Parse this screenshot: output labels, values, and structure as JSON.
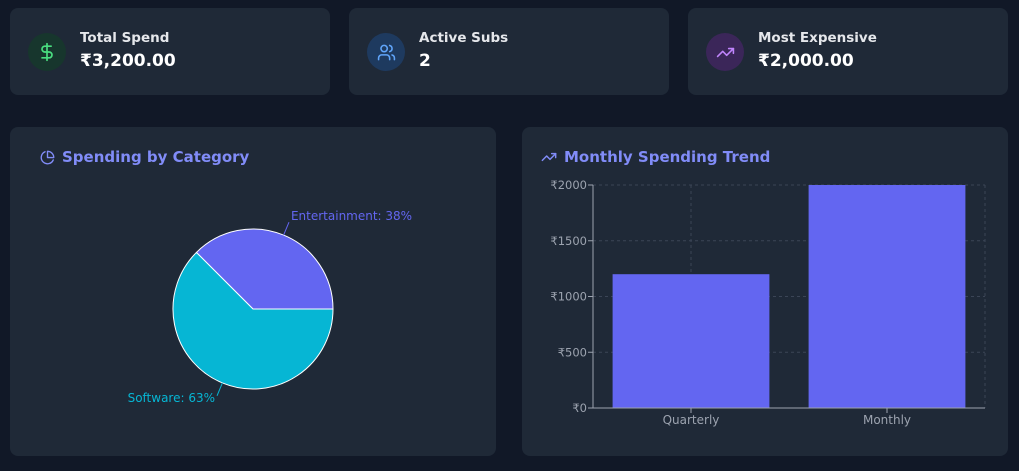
{
  "stats": [
    {
      "label": "Total Spend",
      "value": "₹3,200.00",
      "icon": "dollar-sign-icon",
      "icon_color": "#4ade80",
      "icon_bg": "#17362d"
    },
    {
      "label": "Active Subs",
      "value": "2",
      "icon": "users-icon",
      "icon_color": "#60a5fa",
      "icon_bg": "#1e3a5f"
    },
    {
      "label": "Most Expensive",
      "value": "₹2,000.00",
      "icon": "trending-up-icon",
      "icon_color": "#c084fc",
      "icon_bg": "#3b2659"
    }
  ],
  "category_panel": {
    "title": "Spending by Category",
    "icon": "pie-chart-icon"
  },
  "trend_panel": {
    "title": "Monthly Spending Trend",
    "icon": "trending-up-icon"
  },
  "colors": {
    "page_bg": "#111827",
    "card_bg": "#1f2937",
    "accent": "#818cf8",
    "bar": "#6366f1",
    "entertainment": "#6366f1",
    "software": "#06b6d4",
    "axis": "#9ca3af"
  },
  "chart_data": [
    {
      "type": "pie",
      "slices": [
        {
          "label": "Entertainment",
          "percent_label": "38%",
          "value": 1200,
          "color": "#6366f1"
        },
        {
          "label": "Software",
          "percent_label": "63%",
          "value": 2000,
          "color": "#06b6d4"
        }
      ]
    },
    {
      "type": "bar",
      "categories": [
        "Quarterly",
        "Monthly"
      ],
      "values": [
        1200,
        2000
      ],
      "ylim": [
        0,
        2000
      ],
      "yticks": [
        0,
        500,
        1000,
        1500,
        2000
      ],
      "ytick_prefix": "₹",
      "grid": true
    }
  ]
}
